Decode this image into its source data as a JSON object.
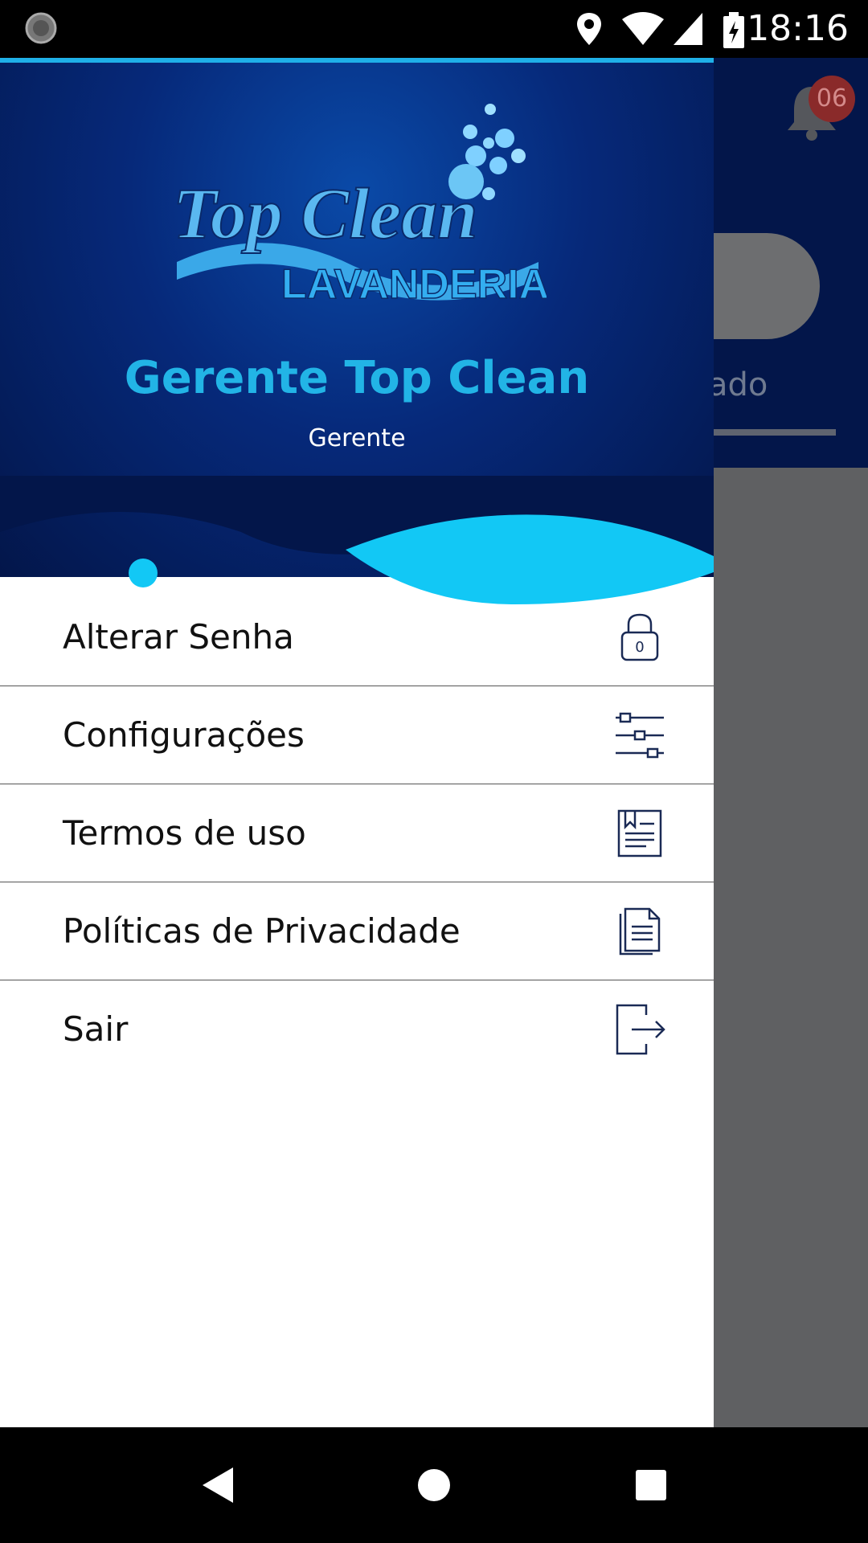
{
  "status_bar": {
    "time": "18:16"
  },
  "background_screen": {
    "notification_count": "06",
    "tab_label_partial": "zado"
  },
  "drawer": {
    "brand_logo": {
      "line1": "Top Clean",
      "line2": "LAVANDERIA"
    },
    "profile": {
      "name": "Gerente Top Clean",
      "role": "Gerente"
    },
    "menu": [
      {
        "label": "Alterar Senha",
        "icon": "lock-icon"
      },
      {
        "label": "Configurações",
        "icon": "sliders-icon"
      },
      {
        "label": "Termos de uso",
        "icon": "document-bookmark-icon"
      },
      {
        "label": "Políticas de Privacidade",
        "icon": "documents-icon"
      },
      {
        "label": "Sair",
        "icon": "logout-icon"
      }
    ]
  },
  "colors": {
    "accent": "#22b4e6",
    "header_dark": "#03164a",
    "overlay": "#5f6062"
  }
}
